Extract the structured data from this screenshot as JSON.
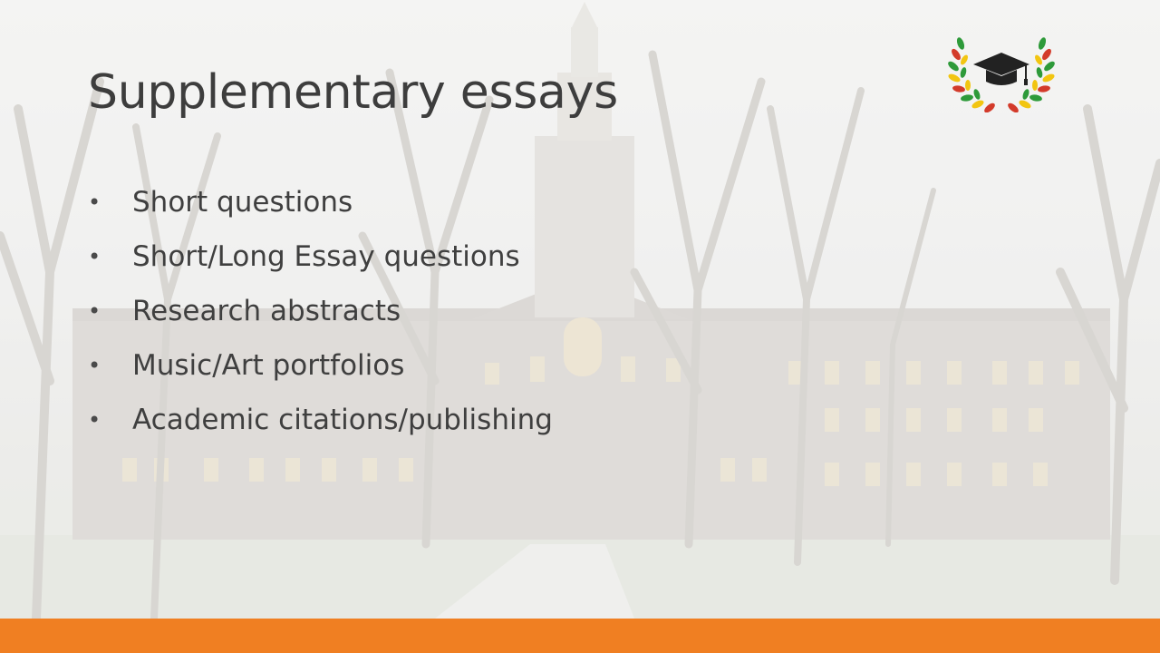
{
  "slide": {
    "title": "Supplementary essays",
    "bullets": [
      "Short questions",
      "Short/Long Essay questions",
      "Research abstracts",
      "Music/Art portfolios",
      "Academic citations/publishing"
    ],
    "bullet_glyph": "•"
  },
  "colors": {
    "accent_bar": "#f07f22",
    "title_text": "#3d3d3d",
    "logo_cap": "#222222",
    "logo_laurel_green": "#2e9a3a",
    "logo_laurel_red": "#d33a2a",
    "logo_laurel_yellow": "#f2c511"
  },
  "icons": {
    "logo": "graduation-cap-laurel-wreath-icon",
    "background": "campus-building-photo"
  }
}
